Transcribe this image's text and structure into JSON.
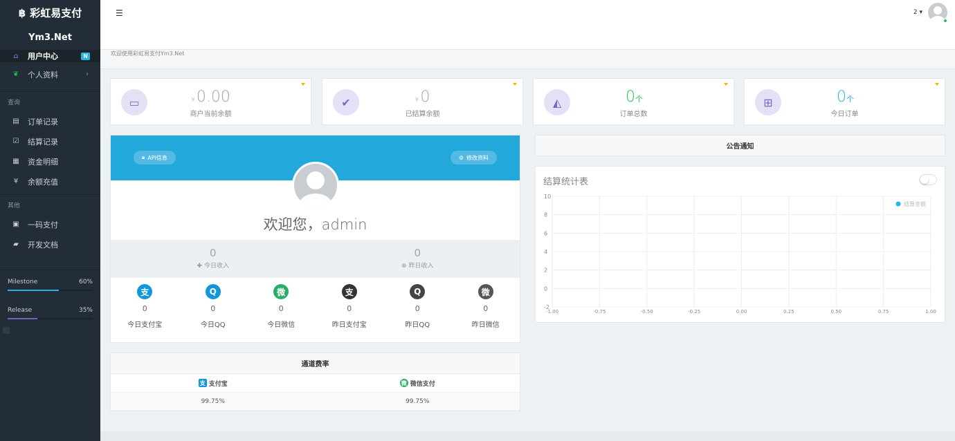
{
  "brand": {
    "title": "彩虹易支付",
    "subtitle": "Ym3.Net"
  },
  "sidebar": {
    "items": [
      {
        "label": "用户中心",
        "icon": "home-icon",
        "badge": "N"
      },
      {
        "label": "个人资料",
        "icon": "leaf-icon"
      }
    ],
    "section_query": "查询",
    "query_items": [
      {
        "label": "订单记录",
        "icon": "list-icon"
      },
      {
        "label": "结算记录",
        "icon": "check-square-icon"
      },
      {
        "label": "资金明细",
        "icon": "table-icon"
      },
      {
        "label": "余额充值",
        "icon": "yen-icon"
      }
    ],
    "section_other": "其他",
    "other_items": [
      {
        "label": "一码支付",
        "icon": "qrcode-icon"
      },
      {
        "label": "开发文档",
        "icon": "book-icon"
      }
    ],
    "progress": [
      {
        "label": "Milestone",
        "percent": "60%",
        "value": 60,
        "color": "#23b7e5"
      },
      {
        "label": "Release",
        "percent": "35%",
        "value": 35,
        "color": "#7266ba"
      }
    ]
  },
  "header": {
    "user_number": "2"
  },
  "breadcrumb": "欢迎使用彩虹易支付Ym3.Net",
  "stats": [
    {
      "currency": "¥",
      "value": "0.00",
      "unit": "",
      "label": "商户当前余额",
      "icon": "money-icon",
      "color": "#98a6ad"
    },
    {
      "currency": "¥",
      "value": "0",
      "unit": "",
      "label": "已结算余额",
      "icon": "check-icon",
      "color": "#98a6ad"
    },
    {
      "currency": "",
      "value": "0",
      "unit": "个",
      "label": "订单总数",
      "icon": "area-chart-icon",
      "color": "#27c24c"
    },
    {
      "currency": "",
      "value": "0",
      "unit": "个",
      "label": "今日订单",
      "icon": "cart-icon",
      "color": "#23b7e5"
    }
  ],
  "profile": {
    "api_button": "API信息",
    "edit_button": "修改资料",
    "welcome": "欢迎您，admin",
    "today_income": {
      "value": "0",
      "label": "今日收入"
    },
    "yesterday_income": {
      "value": "0",
      "label": "昨日收入"
    },
    "channels": [
      {
        "label": "今日支付宝",
        "value": "0",
        "glyph": "支",
        "color": "#1296db"
      },
      {
        "label": "今日QQ",
        "value": "0",
        "glyph": "Q",
        "color": "#1296db"
      },
      {
        "label": "今日微信",
        "value": "0",
        "glyph": "微",
        "color": "#2aae67"
      },
      {
        "label": "昨日支付宝",
        "value": "0",
        "glyph": "支",
        "color": "#333333"
      },
      {
        "label": "昨日QQ",
        "value": "0",
        "glyph": "Q",
        "color": "#444444"
      },
      {
        "label": "昨日微信",
        "value": "0",
        "glyph": "微",
        "color": "#555555"
      }
    ]
  },
  "rate": {
    "title": "通道费率",
    "columns": [
      {
        "name": "支付宝",
        "rate": "99.75%",
        "color": "#1296db",
        "glyph": "支"
      },
      {
        "name": "微信支付",
        "rate": "99.75%",
        "color": "#2aae67",
        "glyph": "微"
      }
    ]
  },
  "notice": {
    "title": "公告通知"
  },
  "chart_data": {
    "type": "line",
    "title": "结算统计表",
    "series": [
      {
        "name": "结算金额",
        "values": [],
        "color": "#23b7e5"
      }
    ],
    "x_ticks": [
      "-1.00",
      "-0.75",
      "-0.50",
      "-0.25",
      "0.00",
      "0.25",
      "0.50",
      "0.75",
      "1.00"
    ],
    "y_ticks": [
      "10",
      "8",
      "6",
      "4",
      "2",
      "0",
      "-2"
    ],
    "xlim": [
      -1,
      1
    ],
    "ylim": [
      -2,
      10
    ],
    "grid": true,
    "legend": "top-right"
  }
}
